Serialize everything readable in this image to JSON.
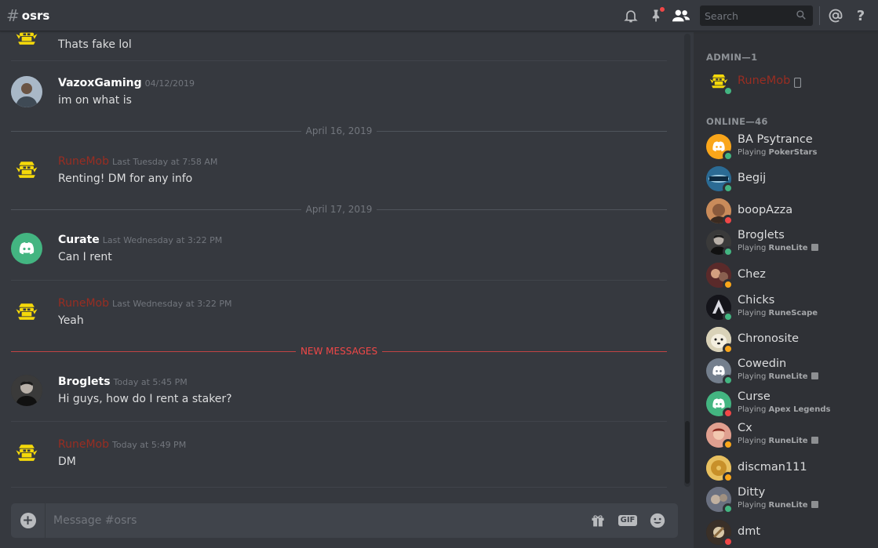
{
  "header": {
    "hash": "#",
    "channel": "osrs",
    "search_placeholder": "Search",
    "icons": [
      "bell-icon",
      "pin-icon",
      "members-icon",
      "search-icon",
      "at-icon",
      "help-icon"
    ]
  },
  "messages": [
    {
      "user": "",
      "timestamp": "",
      "text": "Thats fake lol",
      "avatar": "runemob-logo"
    },
    {
      "user": "VazoxGaming",
      "timestamp": "04/12/2019",
      "text": "im on what is",
      "avatar": "photo"
    },
    {
      "user": "RuneMob",
      "timestamp": "Last Tuesday at 7:58 AM",
      "text": "Renting! DM for any info",
      "avatar": "runemob-logo"
    },
    {
      "user": "Curate",
      "timestamp": "Last Wednesday at 3:22 PM",
      "text": "Can I rent",
      "avatar": "discord-logo"
    },
    {
      "user": "RuneMob",
      "timestamp": "Last Wednesday at 3:22 PM",
      "text": "Yeah",
      "avatar": "runemob-logo"
    },
    {
      "user": "Broglets",
      "timestamp": "Today at 5:45 PM",
      "text": "Hi guys, how do I rent a staker?",
      "avatar": "photo"
    },
    {
      "user": "RuneMob",
      "timestamp": "Today at 5:49 PM",
      "text": "DM",
      "avatar": "runemob-logo"
    }
  ],
  "dividers": {
    "date1": "April 16, 2019",
    "date2": "April 17, 2019",
    "new_messages": "NEW MESSAGES"
  },
  "composer": {
    "placeholder": "Message #osrs",
    "gif": "GIF"
  },
  "members": {
    "admin_header": "ADMIN—1",
    "online_header": "ONLINE—46",
    "admin": [
      {
        "name": "RuneMob",
        "status": "online"
      }
    ],
    "online": [
      {
        "name": "BA Psytrance",
        "status": "online",
        "activity_prefix": "Playing ",
        "activity": "PokerStars"
      },
      {
        "name": "Begij",
        "status": "online",
        "activity_prefix": "",
        "activity": ""
      },
      {
        "name": "boopAzza",
        "status": "dnd",
        "activity_prefix": "",
        "activity": ""
      },
      {
        "name": "Broglets",
        "status": "online",
        "activity_prefix": "Playing ",
        "activity": "RuneLite"
      },
      {
        "name": "Chez",
        "status": "idle",
        "activity_prefix": "",
        "activity": ""
      },
      {
        "name": "Chicks",
        "status": "online",
        "activity_prefix": "Playing ",
        "activity": "RuneScape"
      },
      {
        "name": "Chronosite",
        "status": "idle",
        "activity_prefix": "",
        "activity": ""
      },
      {
        "name": "Cowedin",
        "status": "online",
        "activity_prefix": "Playing ",
        "activity": "RuneLite"
      },
      {
        "name": "Curse",
        "status": "dnd",
        "activity_prefix": "Playing ",
        "activity": "Apex Legends"
      },
      {
        "name": "Cx",
        "status": "idle",
        "activity_prefix": "Playing ",
        "activity": "RuneLite"
      },
      {
        "name": "discman111",
        "status": "idle",
        "activity_prefix": "",
        "activity": ""
      },
      {
        "name": "Ditty",
        "status": "online",
        "activity_prefix": "Playing ",
        "activity": "RuneLite"
      },
      {
        "name": "dmt",
        "status": "dnd",
        "activity_prefix": "",
        "activity": ""
      }
    ]
  },
  "colors": {
    "background": "#36393f",
    "sidebar": "#2f3136",
    "admin_role": "#992d22",
    "new_messages": "#f04747",
    "online": "#43b581",
    "idle": "#faa61a",
    "dnd": "#f04747"
  }
}
